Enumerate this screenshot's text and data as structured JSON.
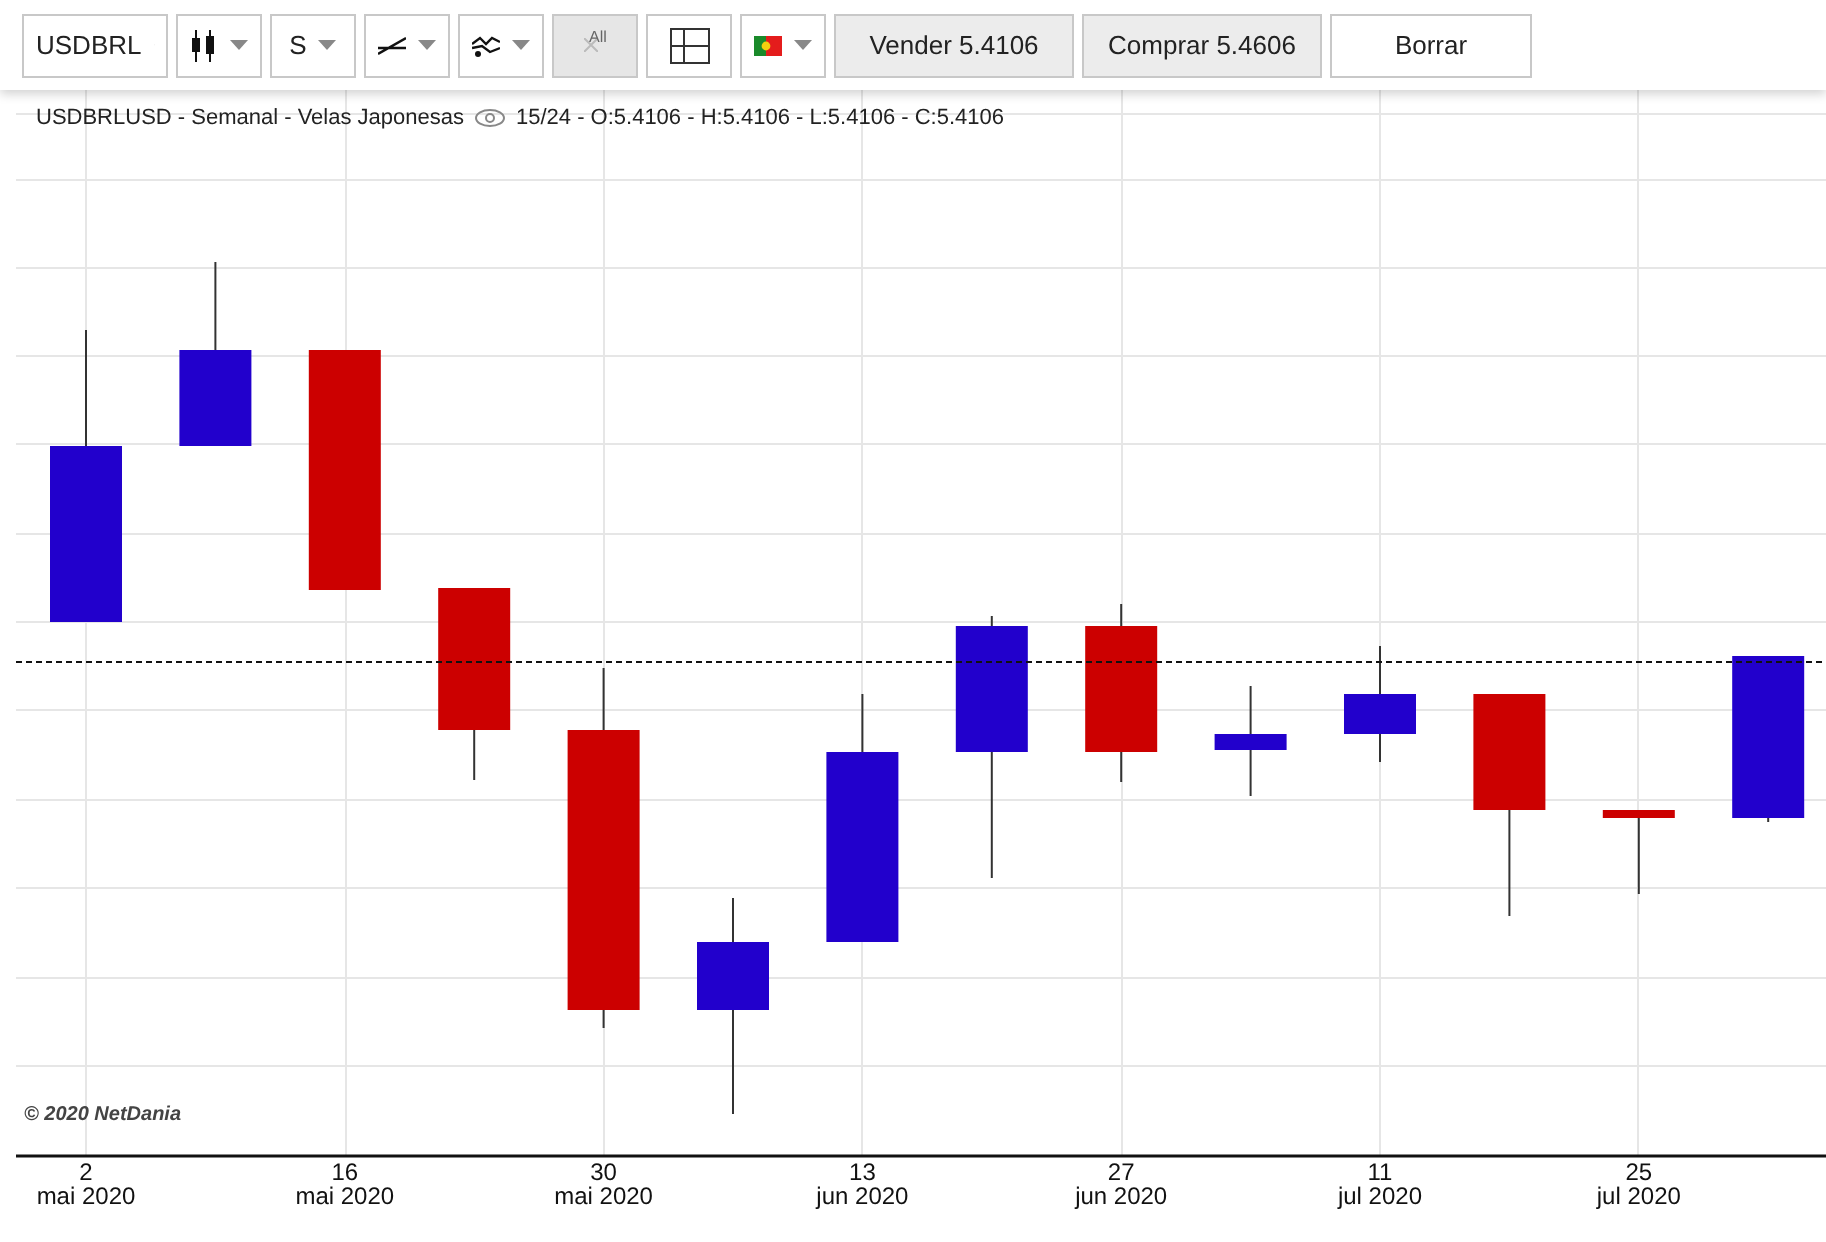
{
  "toolbar": {
    "symbol": "USDBRL",
    "period": "S",
    "clear_all": {
      "label": "All",
      "disabled": true
    },
    "sell": "Vender 5.4106",
    "buy": "Comprar 5.4606",
    "clear": "Borrar"
  },
  "chart": {
    "legend": "USDBRLUSD - Semanal - Velas Japonesas",
    "ohlc": "15/24 - O:5.4106 - H:5.4106 - L:5.4106 - C:5.4106",
    "copyright": "© 2020 NetDania",
    "x_labels": [
      {
        "day": "2",
        "month": "mai 2020"
      },
      {
        "day": "16",
        "month": "mai 2020"
      },
      {
        "day": "30",
        "month": "mai 2020"
      },
      {
        "day": "13",
        "month": "jun 2020"
      },
      {
        "day": "27",
        "month": "jun 2020"
      },
      {
        "day": "11",
        "month": "jul 2020"
      },
      {
        "day": "25",
        "month": "jul 2020"
      }
    ]
  }
}
